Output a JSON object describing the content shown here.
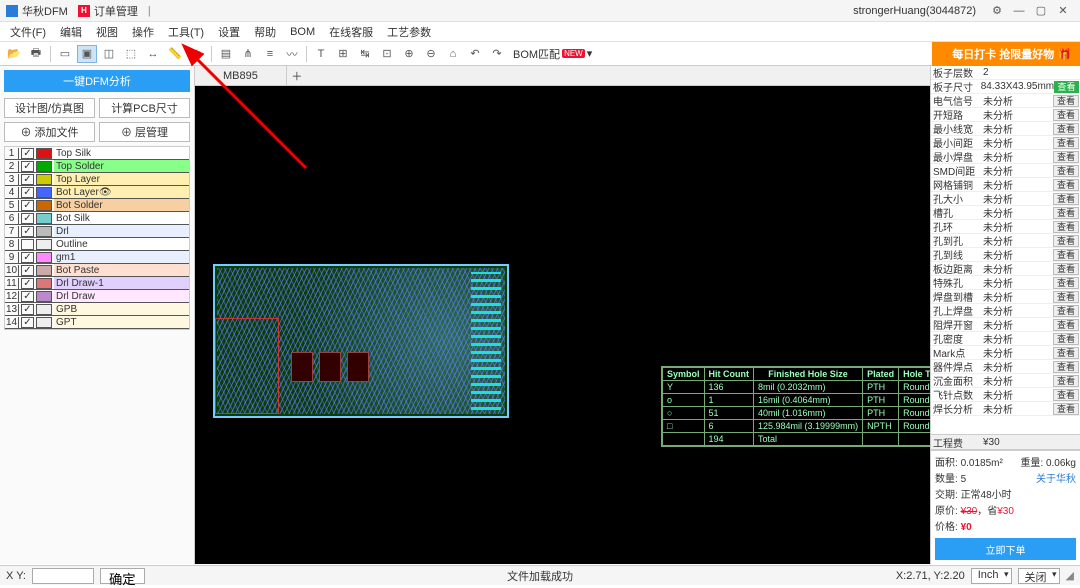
{
  "titlebar": {
    "app": "华秋DFM",
    "doc": "订单管理",
    "user": "strongerHuang(3044872)"
  },
  "menubar": [
    "文件(F)",
    "编辑",
    "视图",
    "操作",
    "工具(T)",
    "设置",
    "帮助",
    "BOM",
    "在线客服",
    "工艺参数"
  ],
  "toolbar": {
    "bom": "BOM匹配",
    "bom_new": "NEW",
    "promo": "每日打卡 抢限量好物"
  },
  "left": {
    "dfm_btn": "一键DFM分析",
    "btnrow1": [
      "设计图/仿真图",
      "计算PCB尺寸"
    ],
    "btnrow2": [
      "⊕ 添加文件",
      "⊕ 层管理"
    ],
    "layers": [
      {
        "n": "1",
        "chk": true,
        "color": "#d11",
        "name": "Top Silk",
        "bg": ""
      },
      {
        "n": "2",
        "chk": true,
        "color": "#0a0",
        "name": "Top Solder",
        "bg": "#8f8"
      },
      {
        "n": "3",
        "chk": true,
        "color": "#cc0",
        "name": "Top Layer",
        "bg": "#ffefb0"
      },
      {
        "n": "4",
        "chk": true,
        "color": "#46f",
        "name": "Bot Layer",
        "bg": "#ffefb0",
        "eye": true
      },
      {
        "n": "5",
        "chk": true,
        "color": "#c60",
        "name": "Bot Solder",
        "bg": "#f8cfa0"
      },
      {
        "n": "6",
        "chk": true,
        "color": "#7cc",
        "name": "Bot Silk",
        "bg": ""
      },
      {
        "n": "7",
        "chk": true,
        "color": "#bbb",
        "name": "Drl",
        "bg": "#e8f0ff"
      },
      {
        "n": "8",
        "chk": false,
        "color": "#eee",
        "name": "Outline",
        "bg": ""
      },
      {
        "n": "9",
        "chk": true,
        "color": "#f8f",
        "name": "gm1",
        "bg": "#e8f0ff"
      },
      {
        "n": "10",
        "chk": true,
        "color": "#caa",
        "name": "Bot Paste",
        "bg": "#ffe0d0"
      },
      {
        "n": "11",
        "chk": true,
        "color": "#d77",
        "name": "Drl Draw-1",
        "bg": "#e0d0ff"
      },
      {
        "n": "12",
        "chk": true,
        "color": "#b8c",
        "name": "Drl Draw",
        "bg": "#ffe8ff"
      },
      {
        "n": "13",
        "chk": true,
        "color": "#eee",
        "name": "GPB",
        "bg": "#fff8e0"
      },
      {
        "n": "14",
        "chk": true,
        "color": "#eee",
        "name": "GPT",
        "bg": "#fff8e0"
      }
    ]
  },
  "center": {
    "tab": "MB895",
    "drill": {
      "headers": [
        "Symbol",
        "Hit Count",
        "Finished Hole Size",
        "Plated",
        "Hole Type"
      ],
      "rows": [
        [
          "Y",
          "136",
          "8mil (0.2032mm)",
          "PTH",
          "Round"
        ],
        [
          "o",
          "1",
          "16mil (0.4064mm)",
          "PTH",
          "Round"
        ],
        [
          "○",
          "51",
          "40mil (1.016mm)",
          "PTH",
          "Round"
        ],
        [
          "□",
          "6",
          "125.984mil (3.19999mm)",
          "NPTH",
          "Round"
        ]
      ],
      "total": [
        "",
        "194",
        "Total",
        "",
        ""
      ]
    }
  },
  "right": {
    "props": [
      {
        "k": "板子层数",
        "v": "2",
        "act": ""
      },
      {
        "k": "板子尺寸",
        "v": "84.33X43.95mm",
        "act": "查看",
        "green": true
      },
      {
        "k": "电气信号",
        "v": "未分析",
        "act": "查看"
      },
      {
        "k": "开短路",
        "v": "未分析",
        "act": "查看"
      },
      {
        "k": "最小线宽",
        "v": "未分析",
        "act": "查看"
      },
      {
        "k": "最小间距",
        "v": "未分析",
        "act": "查看"
      },
      {
        "k": "最小焊盘",
        "v": "未分析",
        "act": "查看"
      },
      {
        "k": "SMD间距",
        "v": "未分析",
        "act": "查看"
      },
      {
        "k": "网格铺铜",
        "v": "未分析",
        "act": "查看"
      },
      {
        "k": "孔大小",
        "v": "未分析",
        "act": "查看"
      },
      {
        "k": "槽孔",
        "v": "未分析",
        "act": "查看"
      },
      {
        "k": "孔环",
        "v": "未分析",
        "act": "查看"
      },
      {
        "k": "孔到孔",
        "v": "未分析",
        "act": "查看"
      },
      {
        "k": "孔到线",
        "v": "未分析",
        "act": "查看"
      },
      {
        "k": "板边距离",
        "v": "未分析",
        "act": "查看"
      },
      {
        "k": "特殊孔",
        "v": "未分析",
        "act": "查看"
      },
      {
        "k": "焊盘到槽",
        "v": "未分析",
        "act": "查看"
      },
      {
        "k": "孔上焊盘",
        "v": "未分析",
        "act": "查看"
      },
      {
        "k": "阻焊开窗",
        "v": "未分析",
        "act": "查看"
      },
      {
        "k": "孔密度",
        "v": "未分析",
        "act": "查看"
      },
      {
        "k": "Mark点",
        "v": "未分析",
        "act": "查看"
      },
      {
        "k": "器件焊点",
        "v": "未分析",
        "act": "查看"
      },
      {
        "k": "沉金面积",
        "v": "未分析",
        "act": "查看"
      },
      {
        "k": "飞针点数",
        "v": "未分析",
        "act": "查看"
      },
      {
        "k": "焊长分析",
        "v": "未分析",
        "act": "查看"
      }
    ],
    "eng_k": "工程费",
    "eng_v": "¥30",
    "area_k": "面积:",
    "area_v": "0.0185m²",
    "weight_k": "重量:",
    "weight_v": "0.06kg",
    "qty_k": "数量:",
    "qty_v": "5",
    "about": "关于华秋",
    "lead_k": "交期:",
    "lead_v": "正常48小时",
    "orig_k": "原价:",
    "orig_v": "¥30",
    "save_k": "，省",
    "save_v": "¥30",
    "price_k": "价格:",
    "price_v": "¥0",
    "order_btn": "立即下单"
  },
  "status": {
    "xy_label": "X Y:",
    "confirm": "确定",
    "msg": "文件加载成功",
    "coord": "X:2.71, Y:2.20",
    "unit": "Inch",
    "close": "关闭"
  }
}
